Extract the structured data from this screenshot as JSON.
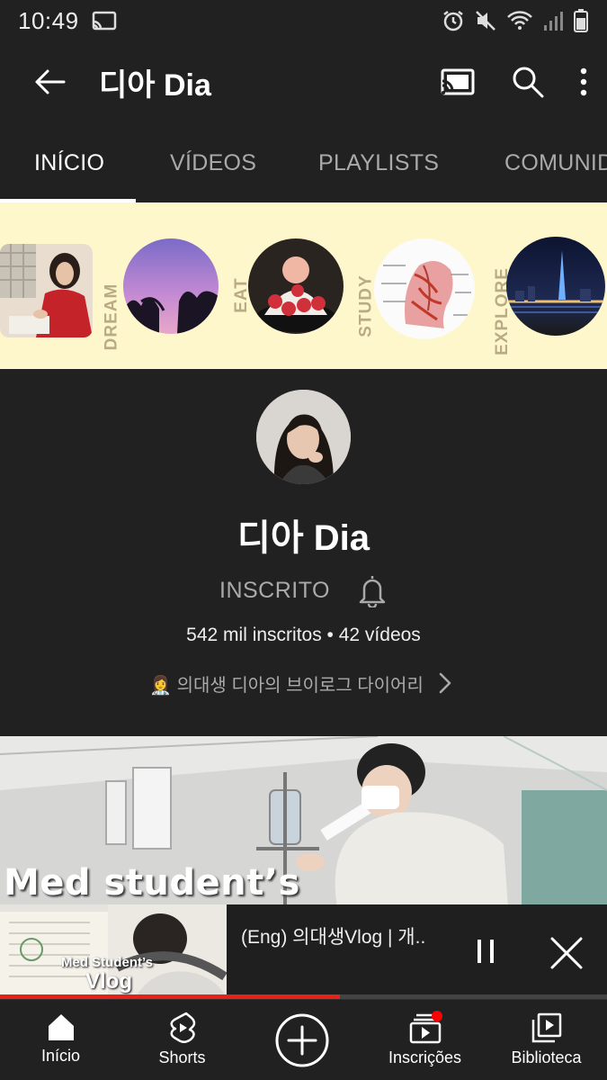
{
  "status_bar": {
    "time": "10:49"
  },
  "header": {
    "title": "디아 Dia",
    "icons": [
      "back-arrow-icon",
      "cast-icon",
      "search-icon",
      "more-vert-icon"
    ]
  },
  "tabs": [
    {
      "label": "INÍCIO",
      "active": true
    },
    {
      "label": "VÍDEOS",
      "active": false
    },
    {
      "label": "PLAYLISTS",
      "active": false
    },
    {
      "label": "COMUNID",
      "active": false
    }
  ],
  "banner": {
    "background": "#fff7cc",
    "words": [
      "DREAM",
      "EAT",
      "STUDY",
      "EXPLORE"
    ]
  },
  "channel": {
    "name": "디아 Dia",
    "subscribe_label": "INSCRITO",
    "stats": "542 mil inscritos • 42 vídeos",
    "tagline": "👩‍⚕️ 의대생 디아의 브이로그 다이어리"
  },
  "video": {
    "thumbnail_caption": "Med student’s"
  },
  "miniplayer": {
    "title": "(Eng) 의대생Vlog | 개..",
    "thumb_line1": "Med Student’s",
    "thumb_line2": "Vlog",
    "progress": 0.56,
    "accent": "#e62117"
  },
  "bottom_nav": [
    {
      "label": "Início",
      "icon": "home-icon"
    },
    {
      "label": "Shorts",
      "icon": "shorts-icon"
    },
    {
      "label": "",
      "icon": "create-icon"
    },
    {
      "label": "Inscrições",
      "icon": "subscriptions-icon"
    },
    {
      "label": "Biblioteca",
      "icon": "library-icon"
    }
  ]
}
